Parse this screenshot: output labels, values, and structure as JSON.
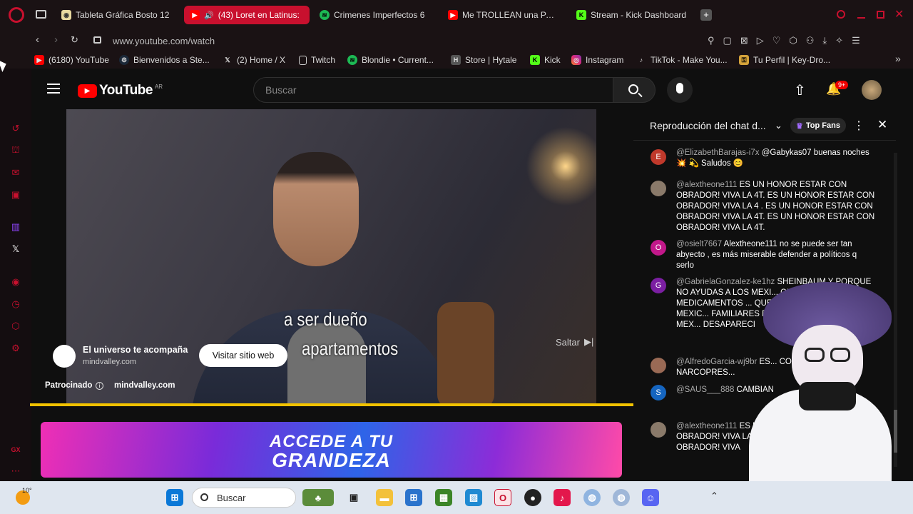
{
  "tabs": [
    {
      "label": "Tableta Gráfica Bosto 12",
      "icon": "shop-icon",
      "color": "#e8d9a0"
    },
    {
      "label": "(43) Loret en Latinus:",
      "icon": "youtube-icon",
      "color": "#ff0000"
    },
    {
      "label": "Crimenes Imperfectos 6",
      "icon": "spotify-icon",
      "color": "#1db954"
    },
    {
      "label": "Me TROLLEAN una PARTI",
      "icon": "youtube-icon",
      "color": "#ff0000"
    },
    {
      "label": "Stream - Kick Dashboard",
      "icon": "kick-icon",
      "color": "#53fc18"
    }
  ],
  "address": {
    "url": "www.youtube.com/watch"
  },
  "bookmarks": [
    {
      "label": "(6180) YouTube",
      "icon": "youtube-icon"
    },
    {
      "label": "Bienvenidos a Ste...",
      "icon": "steam-icon"
    },
    {
      "label": "(2) Home / X",
      "icon": "x-icon"
    },
    {
      "label": "Twitch",
      "icon": "page-icon"
    },
    {
      "label": "Blondie • Current...",
      "icon": "spotify-icon"
    },
    {
      "label": "Store | Hytale",
      "icon": "hytale-icon"
    },
    {
      "label": "Kick",
      "icon": "kick-icon"
    },
    {
      "label": "Instagram",
      "icon": "instagram-icon"
    },
    {
      "label": "TikTok - Make You...",
      "icon": "tiktok-icon"
    },
    {
      "label": "Tu Perfil | Key-Dro...",
      "icon": "keydrop-icon"
    }
  ],
  "youtube": {
    "logo_text": "YouTube",
    "region": "AR",
    "search_placeholder": "Buscar",
    "notif_badge": "9+"
  },
  "video": {
    "subtitle_line1": "a ser dueño",
    "subtitle_line2": "apartamentos",
    "ad_title": "El universo te acompaña",
    "ad_domain": "mindvalley.com",
    "ad_button": "Visitar sitio web",
    "sponsored": "Patrocinado",
    "sponsored_domain": "mindvalley.com",
    "skip": "Saltar",
    "progress": 1.0
  },
  "banner": {
    "line1": "ACCEDE A TU",
    "line2": "GRANDEZA"
  },
  "chat": {
    "title": "Reproducción del chat d...",
    "badge": "Top Fans",
    "messages": [
      {
        "user": "@ElizabethBarajas-i7x",
        "text": "@Gabykas07 buenas noches 💥 💫 Saludos 😊",
        "avatar": "E",
        "color": "#c0392b"
      },
      {
        "user": "@alextheone111",
        "text": "ES UN HONOR ESTAR CON OBRADOR! VIVA LA 4T. ES UN HONOR ESTAR CON OBRADOR! VIVA LA 4 . ES UN HONOR ESTAR CON OBRADOR! VIVA LA 4T. ES UN HONOR ESTAR CON OBRADOR! VIVA LA 4T.",
        "avatar": "",
        "color": "#8a7a6a"
      },
      {
        "user": "@osielt7667",
        "text": "Alextheone111 no se puede ser tan abyecto , es más miserable defender a políticos q serlo",
        "avatar": "O",
        "color": "#c2188a"
      },
      {
        "user": "@GabrielaGonzalez-ke1hz",
        "text": "SHEINBAUM Y PORQUE NO AYUDAS A LOS MEXI... QUE NECESITAMOS MEDICAMENTOS ... QUE NO AYUDAS A LOS MEXIC... FAMILIARES DESAP... AYUDAS A LOS MEX... DESAPARECI",
        "avatar": "G",
        "color": "#7b1fa2"
      },
      {
        "user": "@AlfredoGarcia-wj9br",
        "text": "ES... CON KKDOR NARCOPRES...",
        "avatar": "",
        "color": "#9a6a55"
      },
      {
        "user": "@SAUS___888",
        "text": "CAMBIAN",
        "avatar": "S",
        "color": "#1565c0"
      },
      {
        "user": "@alextheone111",
        "text": "ES U... OBRADOR! VIVA LA 4... OBRADOR! VIVA LA... OBRADOR! VIVA L... OBRADOR! VIVA",
        "avatar": "",
        "color": "#8a7a6a"
      }
    ]
  },
  "taskbar": {
    "search_placeholder": "Buscar",
    "temperature": "10°"
  },
  "sidebar_bottom": "GX"
}
